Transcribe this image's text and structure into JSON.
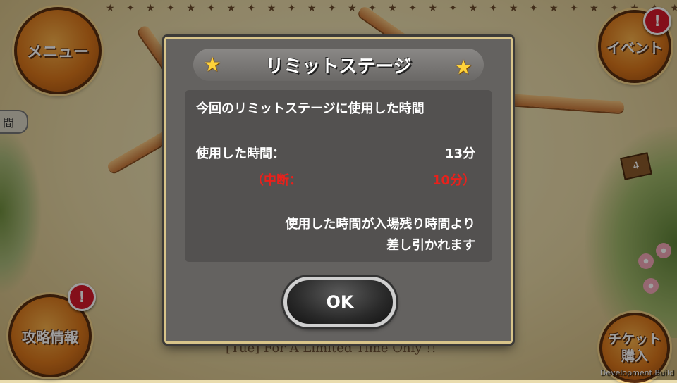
{
  "background": {
    "banner_text": "[Tue] For A Limited Time Only !!",
    "side_tab_label": "間",
    "sign_label": "4",
    "dev_badge": "Development Build"
  },
  "buttons": {
    "menu_label": "メニュー",
    "event_label": "イベント",
    "guide_label": "攻略情報",
    "ticket_label": "チケット\n購入",
    "alert_mark": "!"
  },
  "dialog": {
    "title": "リミットステージ",
    "heading": "今回のリミットステージに使用した時間",
    "used_label": "使用した時間：",
    "used_value": "13分",
    "interrupt_label": "（中断：",
    "interrupt_value": "10分）",
    "message_line1": "使用した時間が入場残り時間より",
    "message_line2": "差し引かれます",
    "ok_label": "OK"
  },
  "colors": {
    "accent_red": "#e8211c",
    "star_yellow": "#ffd23a",
    "dialog_bg": "#646260",
    "button_orange": "#d9761b"
  }
}
